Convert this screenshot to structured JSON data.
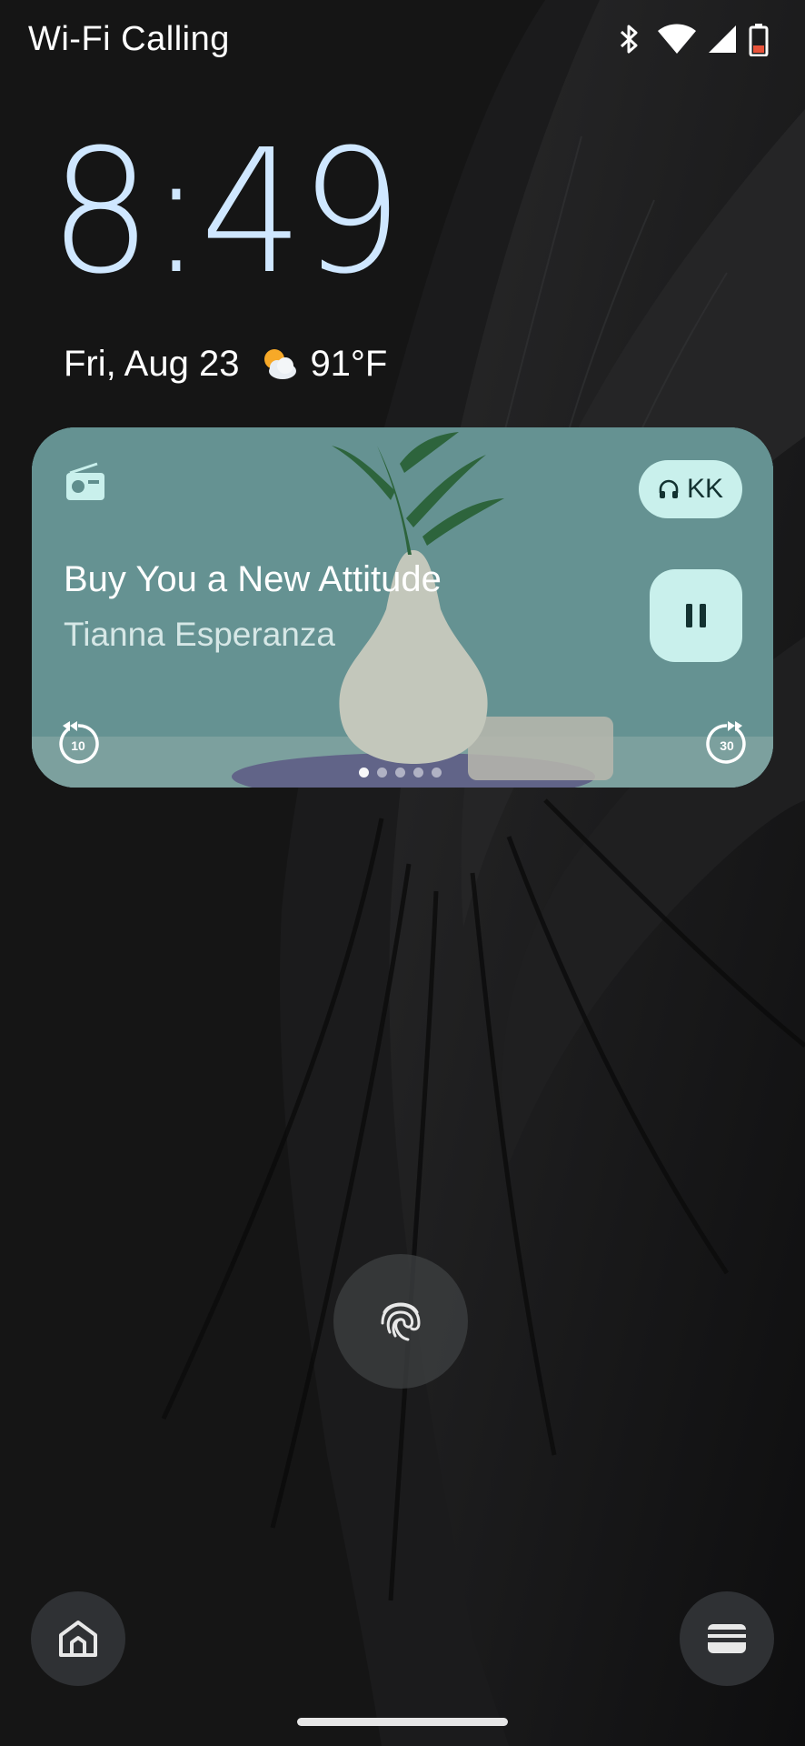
{
  "status_bar": {
    "carrier": "Wi-Fi Calling",
    "icons": [
      "bluetooth-icon",
      "wifi-icon",
      "cell-signal-icon",
      "battery-low-icon"
    ],
    "battery_color": "#e8533a"
  },
  "lockscreen": {
    "time": "8:49",
    "date": "Fri, Aug 23",
    "temperature": "91°F",
    "weather_icon": "partly-cloudy-icon",
    "clock_color": "#cfe7ff"
  },
  "media": {
    "source_icon": "radio-icon",
    "output_device": "KK",
    "output_icon": "headphones-icon",
    "title": "Buy You a New Attitude",
    "artist": "Tianna Esperanza",
    "seek_back_seconds": "10",
    "seek_forward_seconds": "30",
    "pager": {
      "count": 5,
      "active_index": 0
    },
    "accent_color": "#c9f0ec"
  },
  "shortcuts": {
    "left": "home-icon",
    "right": "wallet-icon"
  }
}
